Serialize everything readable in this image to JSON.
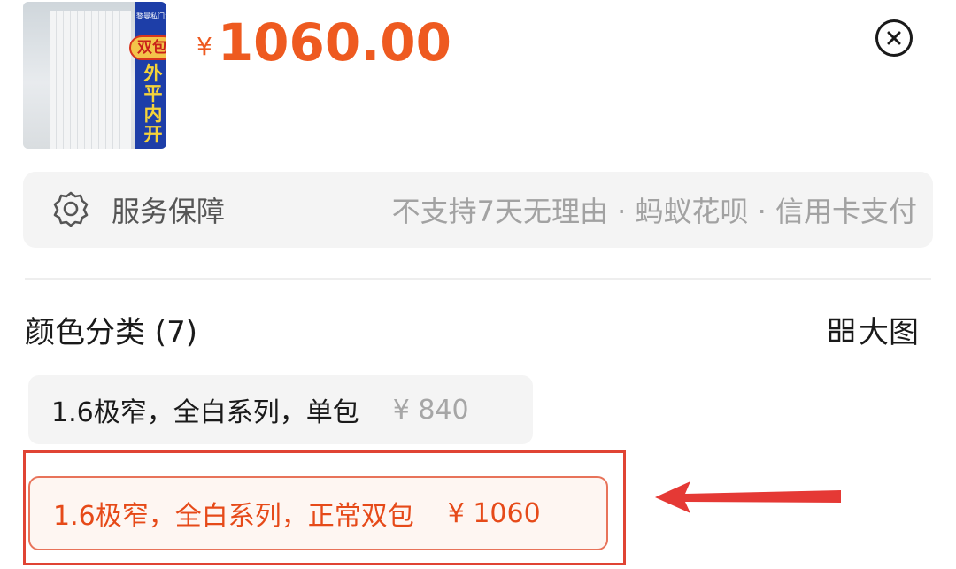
{
  "product": {
    "thumb_logo": "黎曼私门业",
    "thumb_badge": "双包",
    "thumb_vertical": "外平内开",
    "price_symbol": "¥",
    "price": "1060.00"
  },
  "service": {
    "icon": "award-badge-icon",
    "label": "服务保障",
    "description": "不支持7天无理由 · 蚂蚁花呗 · 信用卡支付"
  },
  "variants": {
    "title": "颜色分类 (7)",
    "big_view_label": "大图",
    "big_view_icon": "grid-icon",
    "options": [
      {
        "name": "1.6极窄，全白系列，单包",
        "price": "¥ 840",
        "selected": false
      },
      {
        "name": "1.6极窄，全白系列，正常双包",
        "price": "¥ 1060",
        "selected": true
      }
    ]
  },
  "close_icon": "close-circle-icon",
  "colors": {
    "accent": "#ee5a20",
    "annotation_red": "#e04434",
    "selected_bg": "#fef6f2"
  }
}
